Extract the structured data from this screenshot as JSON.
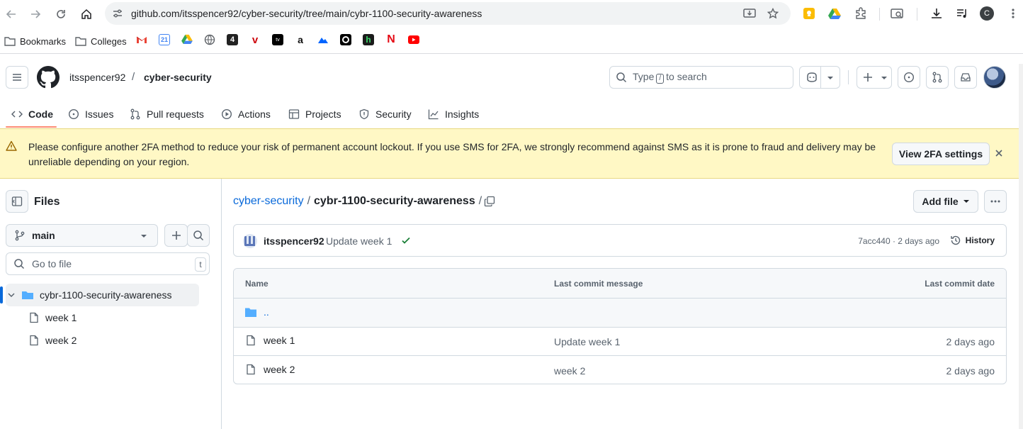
{
  "browser": {
    "url": "github.com/itsspencer92/cyber-security/tree/main/cybr-1100-security-awareness",
    "profile_letter": "C",
    "bookmarks": [
      {
        "label": "Bookmarks",
        "icon": "folder-icon"
      },
      {
        "label": "Colleges",
        "icon": "folder-icon"
      }
    ],
    "bookmark_favicons": [
      "gmail",
      "calendar-21",
      "drive",
      "globe",
      "channel-4",
      "verizon",
      "apple-tv",
      "amazon",
      "paramount",
      "circle-app",
      "hulu",
      "netflix",
      "youtube"
    ],
    "calendar_day": "21"
  },
  "github": {
    "owner": "itsspencer92",
    "separator": "/",
    "repo": "cyber-security",
    "search_placeholder_before": "Type",
    "search_key": "/",
    "search_placeholder_after": "to search",
    "tabs": [
      {
        "label": "Code",
        "icon": "code-icon",
        "active": true
      },
      {
        "label": "Issues",
        "icon": "issue-icon"
      },
      {
        "label": "Pull requests",
        "icon": "pull-request-icon"
      },
      {
        "label": "Actions",
        "icon": "play-icon"
      },
      {
        "label": "Projects",
        "icon": "table-icon"
      },
      {
        "label": "Security",
        "icon": "shield-icon"
      },
      {
        "label": "Insights",
        "icon": "graph-icon"
      }
    ]
  },
  "banner": {
    "message": "Please configure another 2FA method to reduce your risk of permanent account lockout. If you use SMS for 2FA, we strongly recommend against SMS as it is prone to fraud and delivery may be unreliable depending on your region.",
    "button": "View 2FA settings"
  },
  "sidebar": {
    "title": "Files",
    "branch": "main",
    "go_to_file_placeholder": "Go to file",
    "shortcut": "t",
    "tree": [
      {
        "label": "cybr-1100-security-awareness",
        "type": "folder",
        "expanded": true
      },
      {
        "label": "week 1",
        "type": "file"
      },
      {
        "label": "week 2",
        "type": "file"
      }
    ]
  },
  "main": {
    "breadcrumb_root": "cyber-security",
    "breadcrumb_sep": "/",
    "breadcrumb_current": "cybr-1100-security-awareness",
    "breadcrumb_trail": "/",
    "add_file": "Add file",
    "commit": {
      "author": "itsspencer92",
      "message": "Update week 1",
      "sha_time": "7acc440 · 2 days ago",
      "history": "History"
    },
    "table": {
      "headers": {
        "name": "Name",
        "message": "Last commit message",
        "date": "Last commit date"
      },
      "parent": "..",
      "rows": [
        {
          "name": "week 1",
          "message": "Update week 1",
          "date": "2 days ago"
        },
        {
          "name": "week 2",
          "message": "week 2",
          "date": "2 days ago"
        }
      ]
    }
  },
  "colors": {
    "link": "#0969da",
    "banner_bg": "#fff8c5",
    "tab_underline": "#fd8c73",
    "success": "#1a7f37"
  }
}
